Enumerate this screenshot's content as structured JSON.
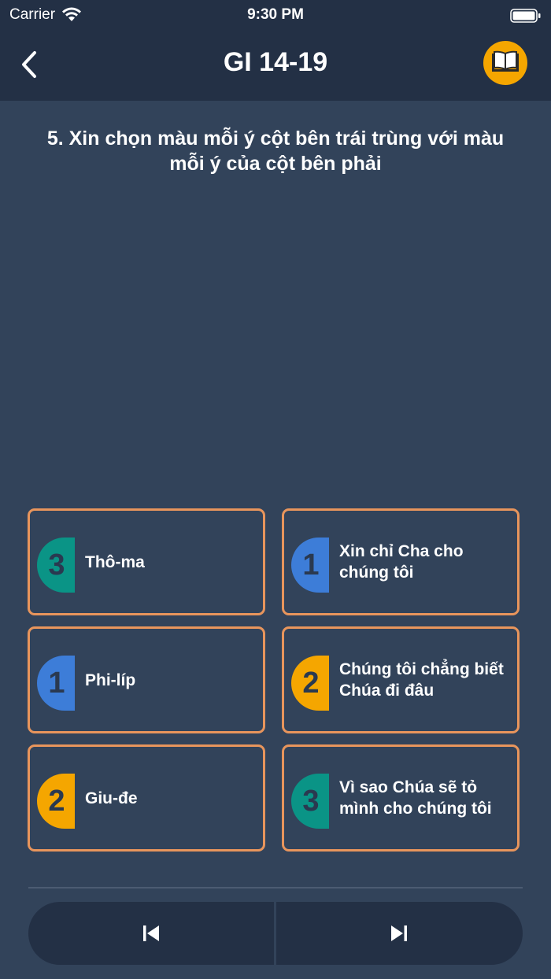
{
  "status_bar": {
    "carrier": "Carrier",
    "time": "9:30 PM"
  },
  "header": {
    "title": "GI 14-19",
    "back_icon": "chevron-left-icon",
    "book_icon": "open-book-icon"
  },
  "question": "5. Xin chọn màu mỗi ý cột bên trái trùng với màu mỗi ý của cột bên phải",
  "colors": {
    "1": "#3d7dd8",
    "2": "#f5a600",
    "3": "#0a9486",
    "card_border": "#e8955c"
  },
  "left_items": [
    {
      "number": "3",
      "label": "Thô-ma"
    },
    {
      "number": "1",
      "label": "Phi-líp"
    },
    {
      "number": "2",
      "label": "Giu-đe"
    }
  ],
  "right_items": [
    {
      "number": "1",
      "label": "Xin chỉ Cha cho chúng tôi"
    },
    {
      "number": "2",
      "label": "Chúng tôi chẳng biết Chúa đi đâu"
    },
    {
      "number": "3",
      "label": "Vì sao Chúa sẽ tỏ mình cho chúng tôi"
    }
  ],
  "navigation": {
    "prev_icon": "skip-previous-icon",
    "next_icon": "skip-next-icon"
  }
}
